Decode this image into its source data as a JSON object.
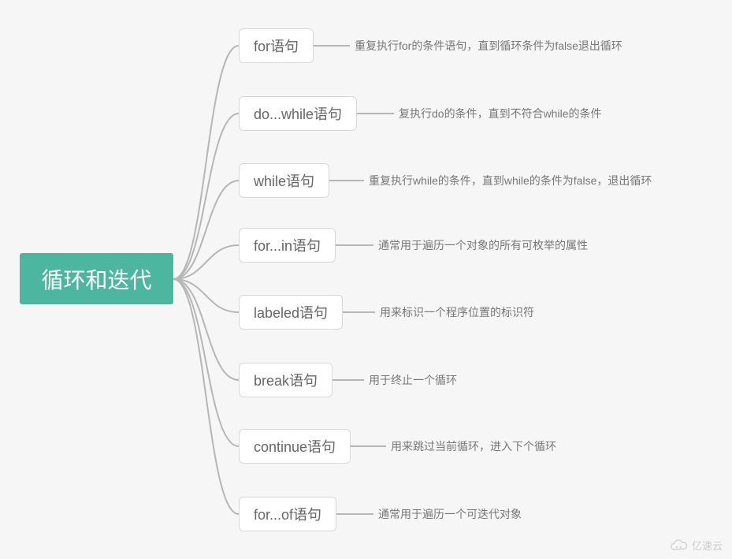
{
  "root": {
    "label": "循环和迭代"
  },
  "branches": [
    {
      "label": "for语句",
      "desc": "重复执行for的条件语句，直到循环条件为false退出循环",
      "midLeft": 303,
      "midTop": 36,
      "midWidth": 96,
      "leafLeft": 450,
      "leafTop": 48
    },
    {
      "label": "do...while语句",
      "desc": "复执行do的条件，直到不符合while的条件",
      "midLeft": 303,
      "midTop": 122,
      "midWidth": 154,
      "leafLeft": 506,
      "leafTop": 134
    },
    {
      "label": "while语句",
      "desc": "重复执行while的条件，直到while的条件为false，退出循环",
      "midLeft": 303,
      "midTop": 207,
      "midWidth": 116,
      "leafLeft": 468,
      "leafTop": 219
    },
    {
      "label": "for...in语句",
      "desc": "通常用于遍历一个对象的所有可枚举的属性",
      "midLeft": 303,
      "midTop": 289,
      "midWidth": 128,
      "leafLeft": 480,
      "leafTop": 301
    },
    {
      "label": "labeled语句",
      "desc": "用来标识一个程序位置的标识符",
      "midLeft": 303,
      "midTop": 374,
      "midWidth": 130,
      "leafLeft": 482,
      "leafTop": 386
    },
    {
      "label": "break语句",
      "desc": "用于终止一个循环",
      "midLeft": 303,
      "midTop": 460,
      "midWidth": 116,
      "leafLeft": 468,
      "leafTop": 472
    },
    {
      "label": "continue语句",
      "desc": "用来跳过当前循环，进入下个循环",
      "midLeft": 303,
      "midTop": 544,
      "midWidth": 144,
      "leafLeft": 496,
      "leafTop": 556
    },
    {
      "label": "for...of语句",
      "desc": "通常用于遍历一个可迭代对象",
      "midLeft": 303,
      "midTop": 630,
      "midWidth": 128,
      "leafLeft": 480,
      "leafTop": 642
    }
  ],
  "watermark": {
    "text": "亿速云"
  },
  "layout": {
    "rootRight": 220,
    "rootCY": 354,
    "midHeight": 44,
    "leafHeight": 20
  }
}
